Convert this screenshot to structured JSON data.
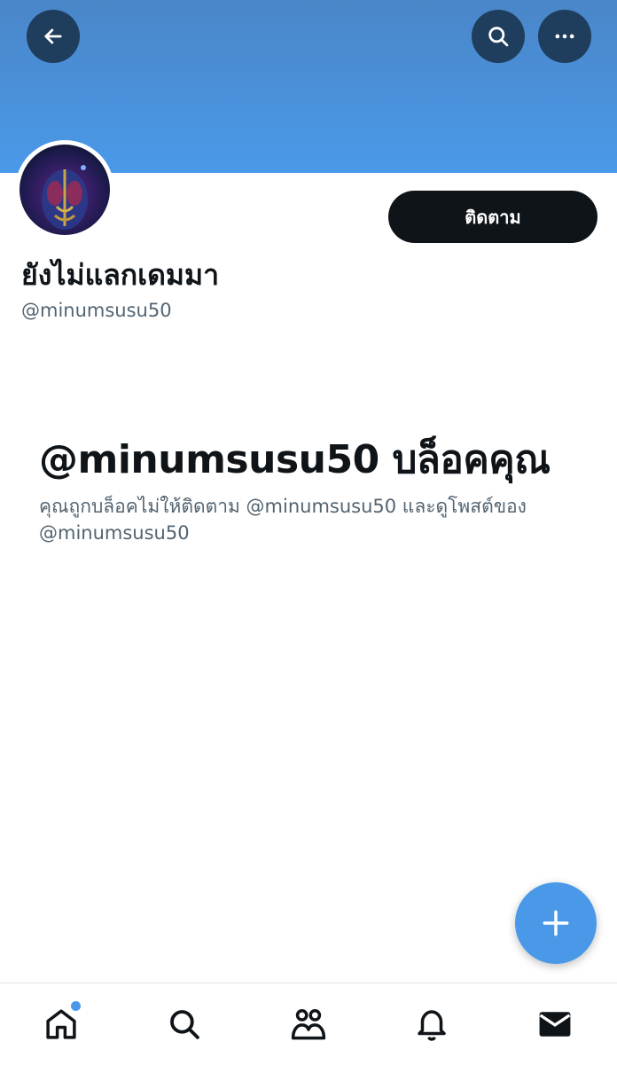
{
  "header": {
    "back_icon": "arrow-left-icon",
    "search_icon": "search-icon",
    "more_icon": "more-horizontal-icon",
    "banner_color": "#4a99e9"
  },
  "profile": {
    "display_name": "ยังไม่แลกเดมมา",
    "handle": "@minumsusu50",
    "follow_label": "ติดตาม"
  },
  "blocked": {
    "title": "@minumsusu50 บล็อคคุณ",
    "description": "คุณถูกบล็อคไม่ให้ติดตาม @minumsusu50 และดูโพสต์ของ @minumsusu50"
  },
  "fab": {
    "icon": "plus-icon",
    "color": "#4a99e9"
  },
  "bottom_nav": {
    "items": [
      {
        "name": "home",
        "icon": "home-icon",
        "has_badge": true
      },
      {
        "name": "search",
        "icon": "search-icon"
      },
      {
        "name": "communities",
        "icon": "people-icon"
      },
      {
        "name": "notifications",
        "icon": "bell-icon"
      },
      {
        "name": "messages",
        "icon": "mail-icon"
      }
    ]
  }
}
